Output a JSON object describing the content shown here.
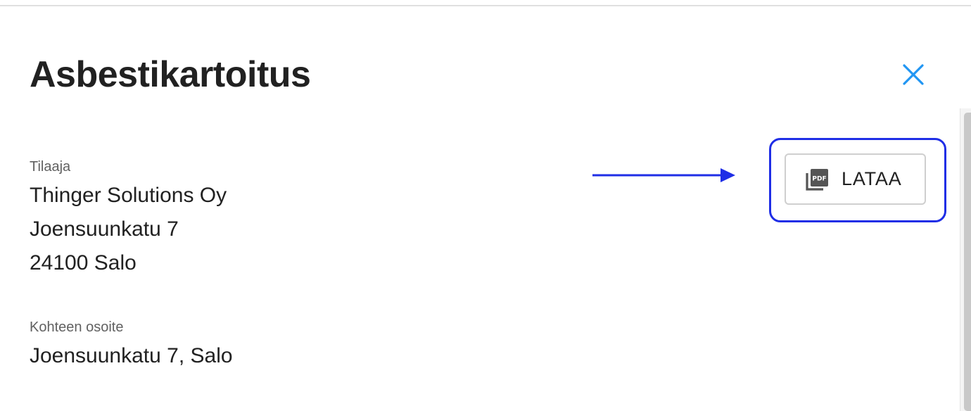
{
  "dialog": {
    "title": "Asbestikartoitus",
    "close_icon": "close-icon"
  },
  "orderer": {
    "label": "Tilaaja",
    "company": "Thinger Solutions Oy",
    "street": "Joensuunkatu 7",
    "postal_city": "24100 Salo"
  },
  "target_address": {
    "label": "Kohteen osoite",
    "value": "Joensuunkatu 7, Salo"
  },
  "download": {
    "label": "LATAA",
    "icon": "pdf-icon"
  },
  "colors": {
    "accent": "#2196f3",
    "annotation": "#1f2ee6"
  }
}
